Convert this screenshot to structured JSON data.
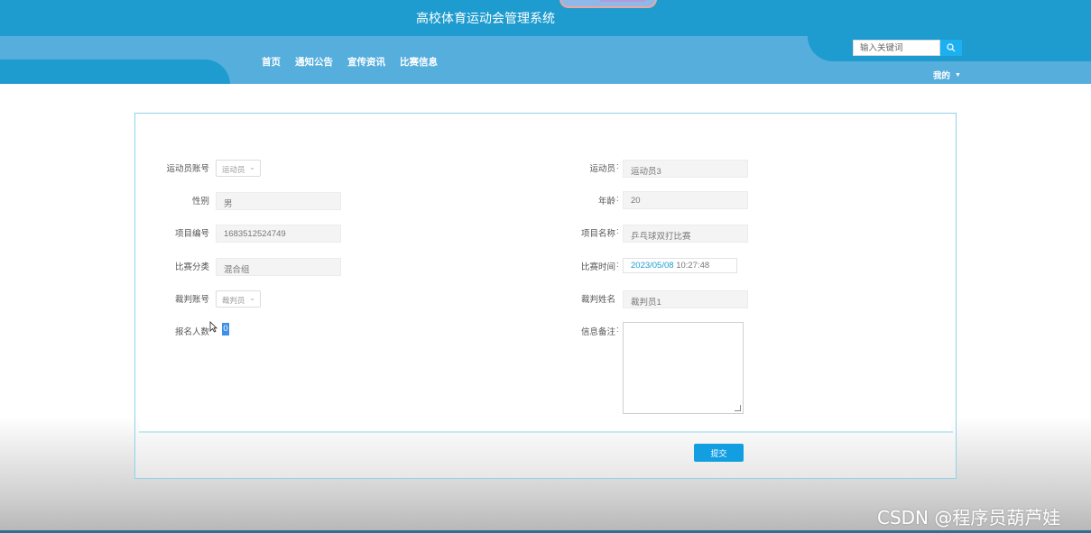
{
  "header": {
    "title": "高校体育运动会管理系统",
    "nav": [
      "首页",
      "通知公告",
      "宣传资讯",
      "比赛信息"
    ],
    "search_placeholder": "输入关键词",
    "user_menu": "我的"
  },
  "form": {
    "left": {
      "athlete_account_label": "运动员账号",
      "athlete_account_value": "运动员",
      "gender_label": "性别",
      "gender_value": "男",
      "project_no_label": "项目编号",
      "project_no_value": "1683512524749",
      "category_label": "比赛分类",
      "category_value": "混合组",
      "referee_account_label": "裁判账号",
      "referee_account_value": "裁判员",
      "signup_count_label": "报名人数",
      "signup_count_value": "0"
    },
    "right": {
      "athlete_label": "运动员",
      "athlete_value": "运动员3",
      "age_label": "年龄",
      "age_value": "20",
      "project_name_label": "项目名称",
      "project_name_value": "乒乓球双打比赛",
      "match_time_label": "比赛时间",
      "match_time_date": "2023/05/08",
      "match_time_time": "10:27:48",
      "referee_name_label": "裁判姓名",
      "referee_name_value": "裁判员1",
      "remarks_label": "信息备注"
    },
    "submit_label": "提交"
  },
  "watermark": "CSDN @程序员葫芦娃",
  "colors": {
    "header": "#1e9bcf",
    "nav_band": "#56aedd",
    "submit": "#129fe2",
    "card_border": "#8fd3ea"
  }
}
